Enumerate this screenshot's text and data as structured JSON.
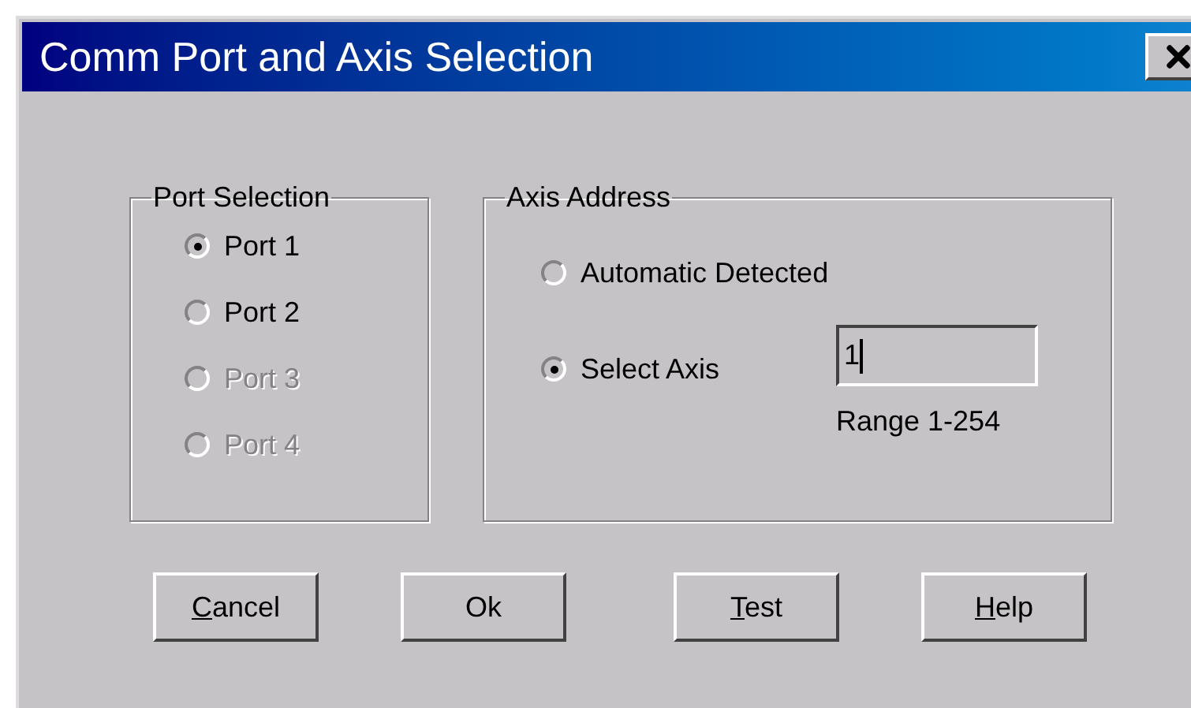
{
  "window": {
    "title": "Comm Port and Axis Selection"
  },
  "port_selection": {
    "label": "Port Selection",
    "options": [
      {
        "label": "Port 1",
        "selected": true,
        "disabled": false
      },
      {
        "label": "Port 2",
        "selected": false,
        "disabled": false
      },
      {
        "label": "Port 3",
        "selected": false,
        "disabled": true
      },
      {
        "label": "Port 4",
        "selected": false,
        "disabled": true
      }
    ]
  },
  "axis_address": {
    "label": "Axis Address",
    "options": [
      {
        "label": "Automatic Detected",
        "selected": false
      },
      {
        "label": "Select Axis",
        "selected": true
      }
    ],
    "axis_field": {
      "value": "1"
    },
    "range": "Range 1-254"
  },
  "buttons": [
    {
      "label": "Cancel",
      "mnemonic": true
    },
    {
      "label": "Ok",
      "mnemonic": false
    },
    {
      "label": "Test",
      "mnemonic": true
    },
    {
      "label": "Help",
      "mnemonic": true
    }
  ]
}
